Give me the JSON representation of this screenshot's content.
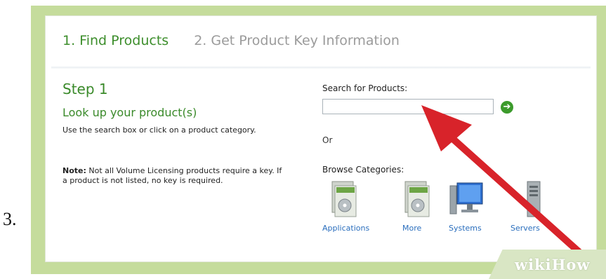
{
  "step_number": "3.",
  "tabs": [
    {
      "label": "1. Find Products"
    },
    {
      "label": "2. Get Product Key Information"
    }
  ],
  "step": {
    "title": "Step 1",
    "subtitle": "Look up your product(s)",
    "description": "Use the search box or click on a product category.",
    "note_label": "Note:",
    "note_text": "Not all Volume Licensing products require a key. If a product is not listed, no key is required."
  },
  "search": {
    "label": "Search for Products:",
    "value": "",
    "go_icon": "arrow-right-circle-icon",
    "or_text": "Or"
  },
  "browse": {
    "label": "Browse Categories:",
    "categories": [
      {
        "label": "Applications",
        "icon": "applications-box-icon"
      },
      {
        "label": "More",
        "icon": "more-box-icon"
      },
      {
        "label": "Systems",
        "icon": "systems-monitor-icon"
      },
      {
        "label": "Servers",
        "icon": "servers-tower-icon"
      }
    ]
  },
  "watermark": "wikiHow",
  "colors": {
    "frame": "#c5dc9c",
    "tab_active": "#3d8e2c",
    "tab_inactive": "#9b9b9b",
    "heading": "#3a8a2a",
    "link": "#2a6ebd",
    "arrow": "#d8232a"
  }
}
